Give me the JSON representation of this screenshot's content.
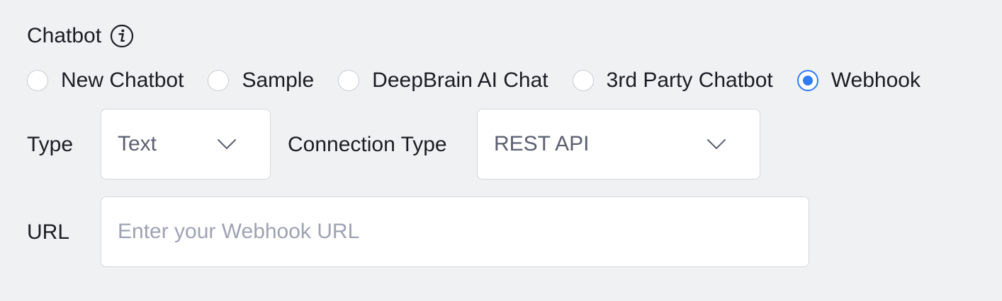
{
  "chatbot": {
    "title": "Chatbot",
    "info_icon": "info-icon",
    "options": [
      {
        "label": "New Chatbot",
        "selected": false
      },
      {
        "label": "Sample",
        "selected": false
      },
      {
        "label": "DeepBrain AI Chat",
        "selected": false
      },
      {
        "label": "3rd Party Chatbot",
        "selected": false
      },
      {
        "label": "Webhook",
        "selected": true
      }
    ]
  },
  "type_field": {
    "label": "Type",
    "value": "Text",
    "icon": "chevron-down-icon"
  },
  "connection_type_field": {
    "label": "Connection Type",
    "value": "REST API",
    "icon": "chevron-down-icon"
  },
  "url_field": {
    "label": "URL",
    "value": "",
    "placeholder": "Enter your Webhook URL"
  },
  "colors": {
    "accent": "#2f7cf6",
    "background": "#f0f1f3",
    "border": "#d6d8dd",
    "placeholder": "#9ea2b3"
  }
}
